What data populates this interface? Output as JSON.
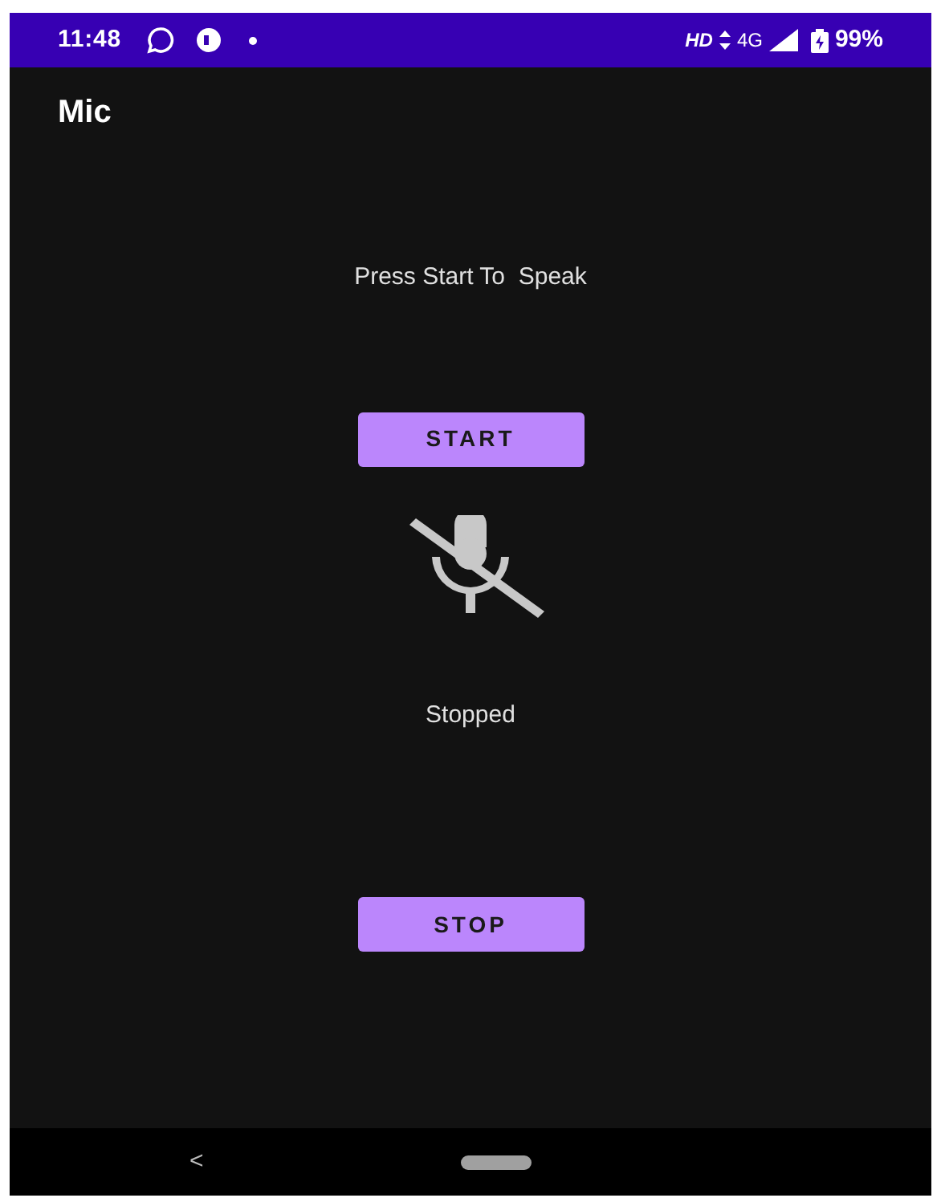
{
  "status_bar": {
    "time": "11:48",
    "hd": "HD",
    "network": "4G",
    "battery": "99%"
  },
  "app_bar": {
    "title": "Mic"
  },
  "prompt": "Press Start To  Speak",
  "start_button": {
    "label": "START"
  },
  "mic": {
    "muted": true
  },
  "status": "Stopped",
  "stop_button": {
    "label": "STOP"
  },
  "nav_bar": {
    "back": "<"
  }
}
